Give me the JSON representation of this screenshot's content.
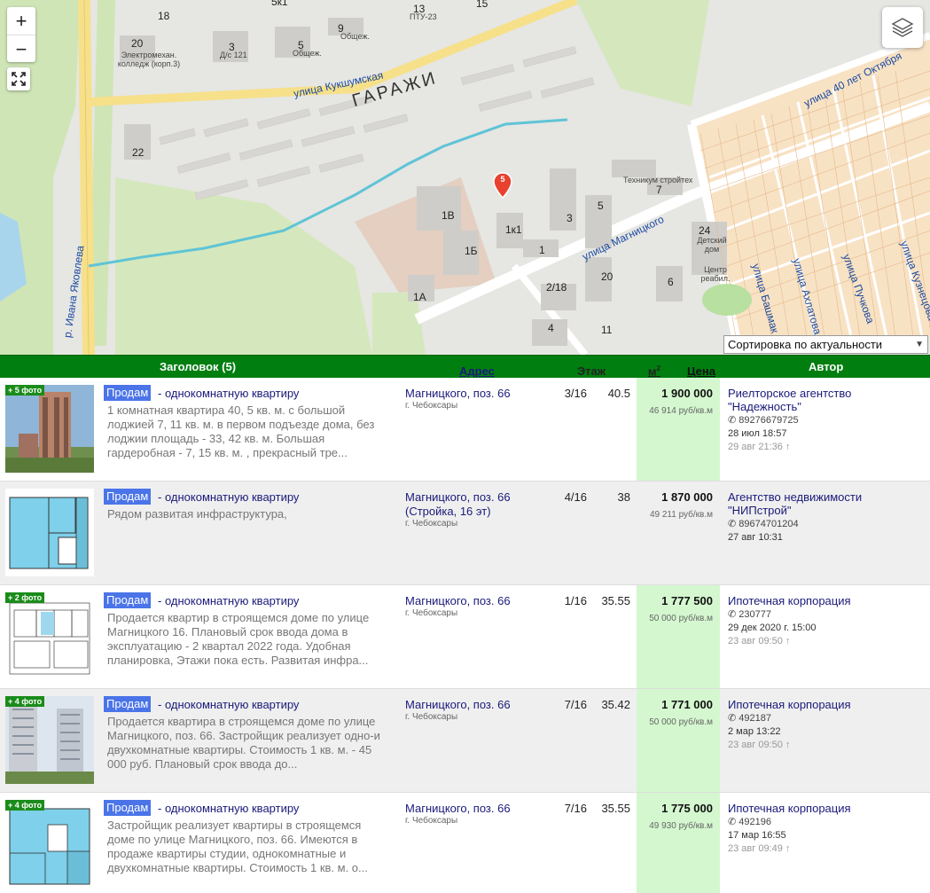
{
  "map": {
    "zoom_in": "+",
    "zoom_out": "−",
    "pin_count": "5",
    "district": "ГАРАЖИ",
    "streets": [
      "улица Кукшумская",
      "улица Магницкого",
      "р. Ивана Яковлева",
      "улица 40 лет Октября",
      "улица Башмак",
      "улица Ахлатова",
      "улица Пучкова",
      "улица Кузнецова"
    ],
    "labels": {
      "college": "Электромехан. колледж (корп.3)",
      "ds121": "Д/с 121",
      "ptu23": "ПТУ-23",
      "obsh1": "Общеж.",
      "obsh2": "Общеж.",
      "technikum": "Техникум стройтех",
      "detsad": "Детский дом",
      "center": "Центр реабил."
    },
    "numbers": {
      "n18": "18",
      "n5k1": "5к1",
      "n15": "15",
      "n20a": "20",
      "n3a": "3",
      "n5a": "5",
      "n9": "9",
      "n13": "13",
      "n22": "22",
      "n1b": "1В",
      "n1bb": "1Б",
      "n1a": "1А",
      "n1k1": "1к1",
      "n1": "1",
      "n3b": "3",
      "n5b": "5",
      "n7": "7",
      "n24": "24",
      "n218": "2/18",
      "n20b": "20",
      "n6": "6",
      "n4": "4",
      "n11": "11"
    }
  },
  "sort": {
    "selected": "Сортировка по актуальности"
  },
  "table": {
    "headers": {
      "title": "Заголовок (5)",
      "address": "Адрес",
      "floor": "Этаж",
      "area": "м",
      "area_sup": "2",
      "price": "Цена",
      "author": "Автор"
    },
    "rows": [
      {
        "photos": "+ 5 фото",
        "deal": "Продам",
        "type": "- однокомнатную квартиру",
        "desc": "1 комнатная квартира 40, 5 кв. м. с большой лоджией 7, 11 кв. м. в первом подъезде дома, без лоджии площадь - 33, 42 кв. м. Большая гардеробная - 7, 15 кв. м. , прекрасный тре...",
        "addr": "Магницкого, поз. 66",
        "city": "г. Чебоксары",
        "floor": "3/16",
        "area": "40.5",
        "price": "1 900 000",
        "ppm": "46 914 руб/кв.м",
        "agent": "Риелторское агентство \"Надежность\"",
        "phone": "89276679725",
        "date1": "28 июл 18:57",
        "date2": "29 авг 21:36 ↑"
      },
      {
        "photos": "",
        "deal": "Продам",
        "type": "- однокомнатную квартиру",
        "desc": "Рядом развитая инфраструктура,",
        "addr": "Магницкого, поз. 66 (Стройка, 16 эт)",
        "city": "г. Чебоксары",
        "floor": "4/16",
        "area": "38",
        "price": "1 870 000",
        "ppm": "49 211 руб/кв.м",
        "agent": "Агентство недвижимости \"НИПстрой\"",
        "phone": "89674701204",
        "date1": "27 авг 10:31",
        "date2": ""
      },
      {
        "photos": "+ 2 фото",
        "deal": "Продам",
        "type": "- однокомнатную квартиру",
        "desc": "Продается квартир в строящемся доме по улице Магницкого 16. Плановый срок ввода дома в эксплуатацию - 2 квартал 2022 года. Удобная планировка, Этажи пока есть. Развитая инфра...",
        "addr": "Магницкого, поз. 66",
        "city": "г. Чебоксары",
        "floor": "1/16",
        "area": "35.55",
        "price": "1 777 500",
        "ppm": "50 000 руб/кв.м",
        "agent": "Ипотечная корпорация",
        "phone": "230777",
        "date1": "29 дек 2020 г. 15:00",
        "date2": "23 авг 09:50 ↑"
      },
      {
        "photos": "+ 4 фото",
        "deal": "Продам",
        "type": "- однокомнатную квартиру",
        "desc": "Продается квартира в строящемся доме по улице Магницкого, поз. 66. Застройщик реализует одно-и двухкомнатные квартиры. Стоимость 1 кв. м. - 45 000 руб. Плановый срок ввода до...",
        "addr": "Магницкого, поз. 66",
        "city": "г. Чебоксары",
        "floor": "7/16",
        "area": "35.42",
        "price": "1 771 000",
        "ppm": "50 000 руб/кв.м",
        "agent": "Ипотечная корпорация",
        "phone": "492187",
        "date1": "2 мар 13:22",
        "date2": "23 авг 09:50 ↑"
      },
      {
        "photos": "+ 4 фото",
        "deal": "Продам",
        "type": "- однокомнатную квартиру",
        "desc": "Застройщик реализует квартиры в строящемся доме по улице Магницкого, поз. 66. Имеются в продаже квартиры студии, однокомнатные и двухкомнатные квартиры. Стоимость 1 кв. м. о...",
        "addr": "Магницкого, поз. 66",
        "city": "г. Чебоксары",
        "floor": "7/16",
        "area": "35.55",
        "price": "1 775 000",
        "ppm": "49 930 руб/кв.м",
        "agent": "Ипотечная корпорация",
        "phone": "492196",
        "date1": "17 мар 16:55",
        "date2": "23 авг 09:49 ↑"
      }
    ]
  }
}
